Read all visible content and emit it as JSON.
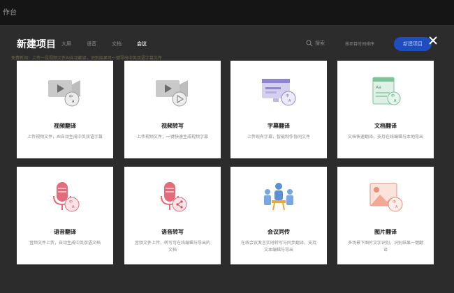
{
  "app": {
    "title": "作台"
  },
  "modal": {
    "title": "新建项目",
    "tabs": [
      {
        "label": "大屏"
      },
      {
        "label": "语音"
      },
      {
        "label": "文档"
      },
      {
        "label": "会议"
      }
    ],
    "search": {
      "label": "搜索"
    },
    "sort": {
      "label": "按项目时间排序"
    },
    "primary_button": {
      "label": "新建项目"
    },
    "notice": "免费新闻：上传一段视频文件AI自动翻译，识别结果可一键导出中英双语字幕文件"
  },
  "cards": [
    {
      "title": "视频翻译",
      "desc": "上传视频文件，AI自动生成中英双语字幕",
      "icon": "video-translate-icon"
    },
    {
      "title": "视频转写",
      "desc": "上传视频文件，一键快速生成视频字幕",
      "icon": "video-transcribe-icon"
    },
    {
      "title": "字幕翻译",
      "desc": "上传现有字幕，智能制作协同文件",
      "icon": "subtitle-translate-icon"
    },
    {
      "title": "文档翻译",
      "desc": "文档快速翻译，支持在线编辑与本地导出",
      "icon": "document-translate-icon"
    },
    {
      "title": "语音翻译",
      "desc": "音频文件上传，自动生成中英双语文档",
      "icon": "audio-translate-icon"
    },
    {
      "title": "语音转写",
      "desc": "音频文件上传，转写可在线编辑与导出的文档",
      "icon": "audio-transcribe-icon"
    },
    {
      "title": "会议同传",
      "desc": "在线会议发言实时转写与同步翻译，支持文本编辑与导出",
      "icon": "meeting-interpret-icon"
    },
    {
      "title": "图片翻译",
      "desc": "多场景下图片文字识别，识别结果一键翻译",
      "icon": "image-translate-icon"
    }
  ]
}
